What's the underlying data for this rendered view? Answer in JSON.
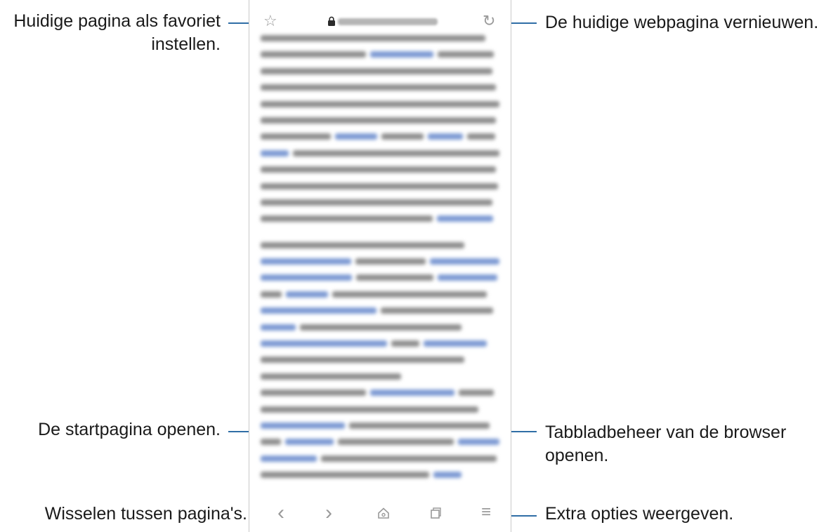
{
  "callouts": {
    "favorite": "Huidige pagina als favoriet\ninstellen.",
    "favorite_line1": "Huidige pagina als favoriet",
    "favorite_line2": "instellen.",
    "refresh": "De huidige webpagina vernieuwen.",
    "home": "De startpagina openen.",
    "tabs_line1": "Tabbladbeheer van de browser",
    "tabs_line2": "openen.",
    "navigate": "Wisselen tussen pagina's.",
    "more": "Extra opties weergeven."
  },
  "icons": {
    "star": "☆",
    "lock": "lock-icon",
    "refresh": "↻",
    "back": "‹",
    "forward": "›",
    "home": "home-icon",
    "tabs": "tabs-icon",
    "menu": "≡"
  },
  "colors": {
    "accent_line": "#2f6ea6",
    "icon_gray": "#9a9a9a",
    "link_blue": "#7d9ad3"
  }
}
